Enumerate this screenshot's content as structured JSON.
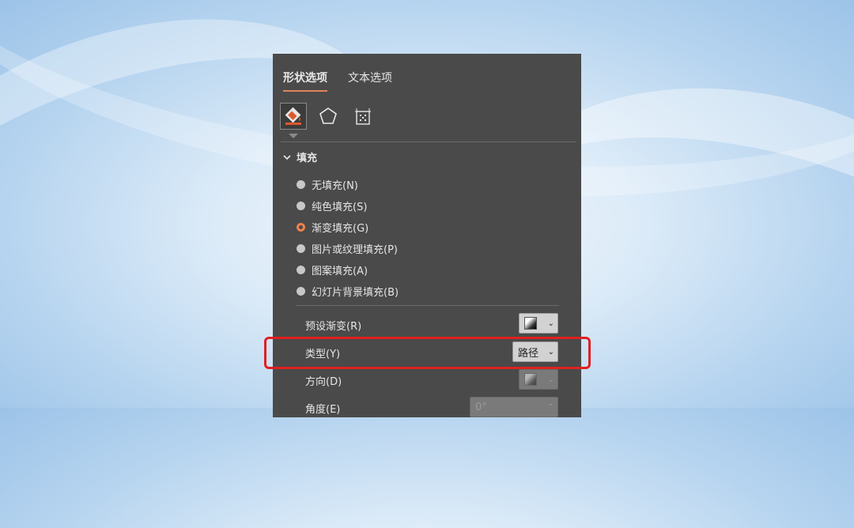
{
  "panel": {
    "tabs": [
      {
        "label": "形状选项",
        "active": true
      },
      {
        "label": "文本选项",
        "active": false
      }
    ],
    "icon_tabs": [
      "fill-line-icon",
      "effects-pentagon-icon",
      "size-properties-icon"
    ],
    "section": {
      "label": "填充",
      "expanded": true
    },
    "fill_options": [
      {
        "label": "无填充(N)",
        "checked": false
      },
      {
        "label": "纯色填充(S)",
        "checked": false
      },
      {
        "label": "渐变填充(G)",
        "checked": true
      },
      {
        "label": "图片或纹理填充(P)",
        "checked": false
      },
      {
        "label": "图案填充(A)",
        "checked": false
      },
      {
        "label": "幻灯片背景填充(B)",
        "checked": false
      }
    ],
    "properties": {
      "preset_gradient": {
        "label": "预设渐变(R)"
      },
      "type": {
        "label": "类型(Y)",
        "value": "路径"
      },
      "direction": {
        "label": "方向(D)",
        "enabled": false
      },
      "angle": {
        "label": "角度(E)",
        "value": "0°",
        "enabled": false
      }
    }
  },
  "colors": {
    "panel_bg": "#4a4a4a",
    "accent": "#f0824d",
    "highlight": "#e02020"
  }
}
